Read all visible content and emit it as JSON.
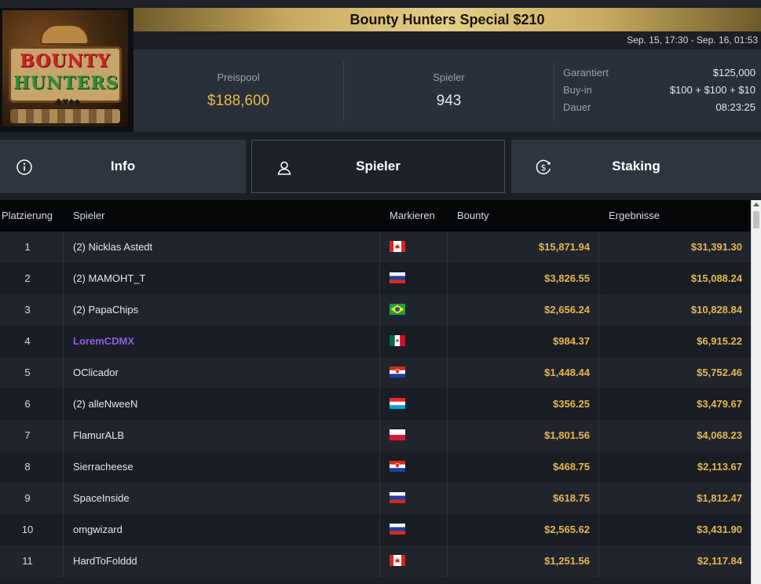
{
  "logo": {
    "line1": "BOUNTY",
    "line2": "HUNTERS",
    "suits": "♣♥♦♠"
  },
  "tournament": {
    "title": "Bounty Hunters Special $210",
    "dates": "Sep. 15, 17:30 - Sep. 16, 01:53"
  },
  "stats": {
    "prizepool_label": "Preispool",
    "prizepool_value": "$188,600",
    "players_label": "Spieler",
    "players_value": "943",
    "guaranteed_label": "Garantiert",
    "guaranteed_value": "$125,000",
    "buyin_label": "Buy-in",
    "buyin_value": "$100 + $100 + $10",
    "duration_label": "Dauer",
    "duration_value": "08:23:25"
  },
  "tabs": {
    "info": "Info",
    "players": "Spieler",
    "staking": "Staking",
    "active": "players"
  },
  "table": {
    "headers": {
      "place": "Platzierung",
      "player": "Spieler",
      "flag": "Markieren",
      "bounty": "Bounty",
      "results": "Ergebnisse"
    },
    "rows": [
      {
        "place": "1",
        "name": "(2) Nicklas Astedt",
        "flag": "ca",
        "bounty": "$15,871.94",
        "result": "$31,391.30"
      },
      {
        "place": "2",
        "name": "(2) MAMOHT_T",
        "flag": "ru",
        "bounty": "$3,826.55",
        "result": "$15,088.24"
      },
      {
        "place": "3",
        "name": "(2) PapaChips",
        "flag": "br",
        "bounty": "$2,656.24",
        "result": "$10,828.84"
      },
      {
        "place": "4",
        "name": "LoremCDMX",
        "flag": "mx",
        "bounty": "$984.37",
        "result": "$6,915.22",
        "highlight": true
      },
      {
        "place": "5",
        "name": "OClicador",
        "flag": "hr",
        "bounty": "$1,448.44",
        "result": "$5,752.46"
      },
      {
        "place": "6",
        "name": "(2) alleNweeN",
        "flag": "lu",
        "bounty": "$356.25",
        "result": "$3,479.67"
      },
      {
        "place": "7",
        "name": "FlamurALB",
        "flag": "pl",
        "bounty": "$1,801.56",
        "result": "$4,068.23"
      },
      {
        "place": "8",
        "name": "Sierracheese",
        "flag": "hr",
        "bounty": "$468.75",
        "result": "$2,113.67"
      },
      {
        "place": "9",
        "name": "SpaceInside",
        "flag": "ru",
        "bounty": "$618.75",
        "result": "$1,812.47"
      },
      {
        "place": "10",
        "name": "omgwizard",
        "flag": "ru",
        "bounty": "$2,565.62",
        "result": "$3,431.90"
      },
      {
        "place": "11",
        "name": "HardToFolddd",
        "flag": "ca",
        "bounty": "$1,251.56",
        "result": "$2,117.84"
      }
    ]
  },
  "colors": {
    "accent_gold": "#e6b64e",
    "highlight_purple": "#8f5de0",
    "panel": "#2a3039"
  }
}
